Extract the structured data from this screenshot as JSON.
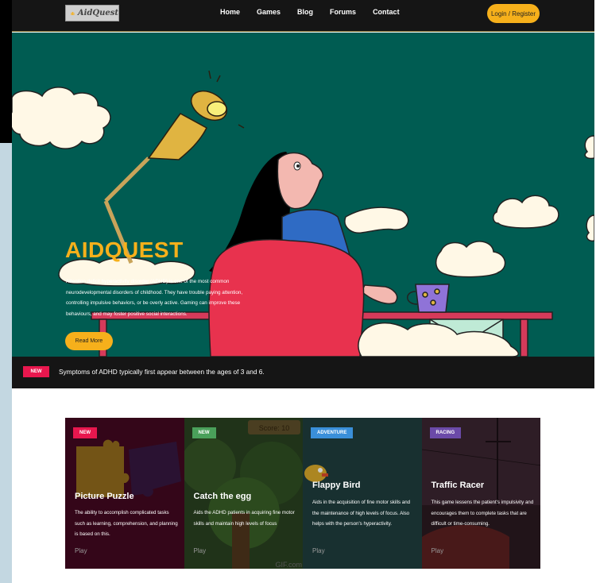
{
  "nav": {
    "logo_text": "AidQuest",
    "links": [
      "Home",
      "Games",
      "Blog",
      "Forums",
      "Contact"
    ],
    "login_label": "Login / Register"
  },
  "hero": {
    "title": "AIDQUEST",
    "description": "Attention deficit hyperactivity disorder (ADHD) is one of the most common neurodevelopmental disorders of childhood. They have trouble paying attention, controlling impulsive behaviors, or be overly active. Gaming can improve these behaviours, and may foster positive social interactions.",
    "button_label": "Read More"
  },
  "ticker": {
    "badge": "NEW",
    "text": "Symptoms of ADHD typically first appear between the ages of 3 and 6."
  },
  "games": [
    {
      "badge": "NEW",
      "badge_color": "#e8174e",
      "title": "Picture Puzzle",
      "description": "The ability to accomplish complicated tasks such as learning, comprehension, and planning is based on this.",
      "play": "Play"
    },
    {
      "badge": "NEW",
      "badge_color": "#4aa05a",
      "title": "Catch the egg",
      "description": "Aids the ADHD patients in acquiring fine motor skills and maintain high levels of focus",
      "play": "Play",
      "art_text_1": "Score: 10",
      "art_text_2": "GIF.com"
    },
    {
      "badge": "ADVENTURE",
      "badge_color": "#3a8fd9",
      "title": "Flappy Bird",
      "description": "Aids in the acquisition of fine motor skills and the maintenance of high levels of focus. Also helps with the person's hyperactivity.",
      "play": "Play"
    },
    {
      "badge": "RACING",
      "badge_color": "#6b4aa8",
      "title": "Traffic Racer",
      "description": "This game lessens the patient's impulsivity and encourages them to complete tasks that are difficult or time-consuming.",
      "play": "Play"
    }
  ],
  "colors": {
    "accent": "#f6b01b",
    "hero_bg": "#005c52",
    "dark": "#151515",
    "chair": "#e8324e"
  }
}
